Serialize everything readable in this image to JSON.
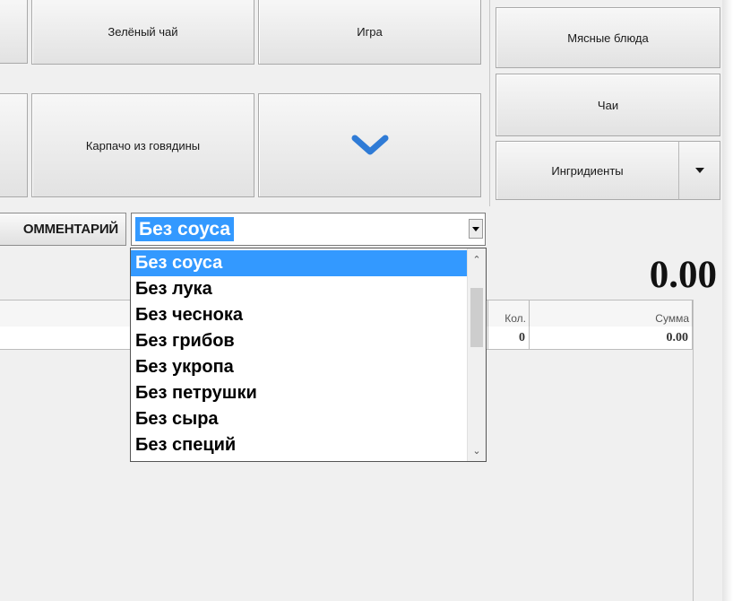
{
  "menu": {
    "tiles": [
      {
        "label": "Зелёный чай"
      },
      {
        "label": "Игра"
      },
      {
        "label": "Карпачо из говядины"
      }
    ],
    "scroll_down": {
      "icon": "chevron-down-icon",
      "color": "#2f7bd6"
    }
  },
  "categories": {
    "items": [
      {
        "label": "Мясные блюда"
      },
      {
        "label": "Чаи"
      }
    ],
    "dropdown": {
      "label": "Ингридиенты",
      "icon": "caret-down-icon"
    }
  },
  "comment": {
    "button_label": "ОММЕНТАРИЙ",
    "selected_value": "Без соуса",
    "options": [
      "Без соуса",
      "Без лука",
      "Без чеснока",
      "Без грибов",
      "Без укропа",
      "Без петрушки",
      "Без сыра",
      "Без специй"
    ],
    "highlight_color": "#3399ff"
  },
  "order": {
    "total": "0.00",
    "columns": [
      {
        "label": ""
      },
      {
        "label": "Кол."
      },
      {
        "label": "Сумма"
      }
    ],
    "rows": [
      {
        "name": "",
        "qty": "0",
        "sum": "0.00"
      }
    ]
  }
}
